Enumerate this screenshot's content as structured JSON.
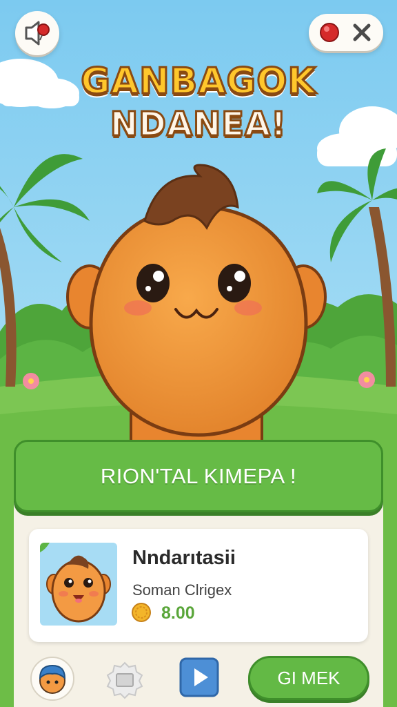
{
  "header": {
    "title_line1": "GANBAGOK",
    "title_line2": "NDANEA!",
    "sound_button": "speaker-icon",
    "record_button": "red-record-icon",
    "close_button": "close-icon"
  },
  "banner": {
    "label": "RION'TAL KIMEPA !"
  },
  "card": {
    "title": "Nndarıtasii",
    "subtitle": "Soman Clrigex",
    "price": "8.00",
    "currency_icon": "coin-icon"
  },
  "bottom_bar": {
    "icons": [
      "avatar-icon",
      "ticket-icon",
      "play-icon"
    ],
    "go_button": "GI MEK"
  },
  "colors": {
    "sky": "#8fd2f2",
    "grass": "#7cc653",
    "accent_green": "#66bb46",
    "character": "#f0963a",
    "title_yellow": "#ffc72c"
  }
}
